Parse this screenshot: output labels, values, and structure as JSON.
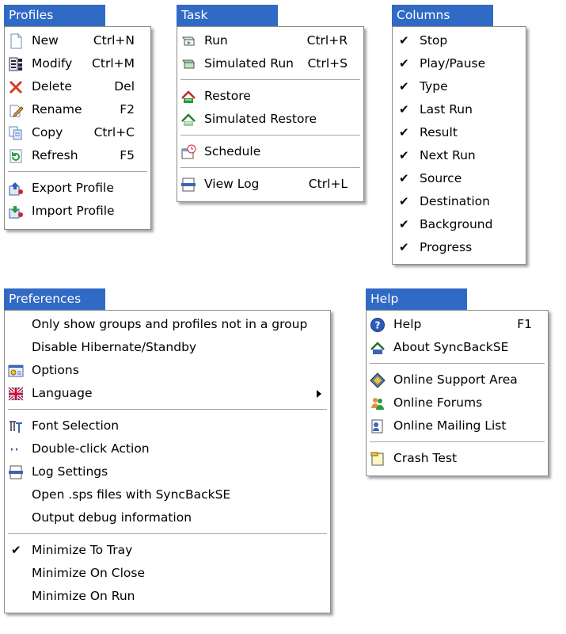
{
  "colors": {
    "title_bg": "#316ac5",
    "title_fg": "#ffffff",
    "menu_bg": "#ffffff",
    "separator": "#a5a5a5"
  },
  "profiles": {
    "title": "Profiles",
    "items": [
      {
        "label": "New",
        "shortcut": "Ctrl+N",
        "icon": "new-document-icon"
      },
      {
        "label": "Modify",
        "shortcut": "Ctrl+M",
        "icon": "modify-icon"
      },
      {
        "label": "Delete",
        "shortcut": "Del",
        "icon": "delete-x-icon"
      },
      {
        "label": "Rename",
        "shortcut": "F2",
        "icon": "rename-pencil-icon"
      },
      {
        "label": "Copy",
        "shortcut": "Ctrl+C",
        "icon": "copy-icon"
      },
      {
        "label": "Refresh",
        "shortcut": "F5",
        "icon": "refresh-icon"
      },
      {
        "label": "Export Profile",
        "shortcut": "",
        "icon": "export-profile-icon"
      },
      {
        "label": "Import Profile",
        "shortcut": "",
        "icon": "import-profile-icon"
      }
    ]
  },
  "task": {
    "title": "Task",
    "items": [
      {
        "label": "Run",
        "shortcut": "Ctrl+R",
        "icon": "run-icon"
      },
      {
        "label": "Simulated Run",
        "shortcut": "Ctrl+S",
        "icon": "simulated-run-icon"
      },
      {
        "label": "Restore",
        "shortcut": "",
        "icon": "restore-icon"
      },
      {
        "label": "Simulated Restore",
        "shortcut": "",
        "icon": "simulated-restore-icon"
      },
      {
        "label": "Schedule",
        "shortcut": "",
        "icon": "schedule-icon"
      },
      {
        "label": "View Log",
        "shortcut": "Ctrl+L",
        "icon": "view-log-icon"
      }
    ]
  },
  "columns": {
    "title": "Columns",
    "items": [
      {
        "label": "Stop",
        "checked": true
      },
      {
        "label": "Play/Pause",
        "checked": true
      },
      {
        "label": "Type",
        "checked": true
      },
      {
        "label": "Last Run",
        "checked": true
      },
      {
        "label": "Result",
        "checked": true
      },
      {
        "label": "Next Run",
        "checked": true
      },
      {
        "label": "Source",
        "checked": true
      },
      {
        "label": "Destination",
        "checked": true
      },
      {
        "label": "Background",
        "checked": true
      },
      {
        "label": "Progress",
        "checked": true
      }
    ]
  },
  "preferences": {
    "title": "Preferences",
    "items": [
      {
        "label": "Only show groups and profiles not in a group",
        "icon": ""
      },
      {
        "label": "Disable Hibernate/Standby",
        "icon": ""
      },
      {
        "label": "Options",
        "icon": "options-icon"
      },
      {
        "label": "Language",
        "icon": "language-flag-icon",
        "submenu": true
      },
      {
        "label": "Font Selection",
        "icon": "font-selection-icon"
      },
      {
        "label": "Double-click Action",
        "icon": "double-click-icon"
      },
      {
        "label": "Log Settings",
        "icon": "log-settings-icon"
      },
      {
        "label": "Open .sps files with SyncBackSE",
        "icon": ""
      },
      {
        "label": "Output debug information",
        "icon": ""
      },
      {
        "label": "Minimize To Tray",
        "checked": true
      },
      {
        "label": "Minimize On Close",
        "checked": false
      },
      {
        "label": "Minimize On Run",
        "checked": false
      }
    ]
  },
  "help": {
    "title": "Help",
    "items": [
      {
        "label": "Help",
        "shortcut": "F1",
        "icon": "help-question-icon"
      },
      {
        "label": "About SyncBackSE",
        "shortcut": "",
        "icon": "about-icon"
      },
      {
        "label": "Online Support Area",
        "shortcut": "",
        "icon": "online-support-icon"
      },
      {
        "label": "Online Forums",
        "shortcut": "",
        "icon": "online-forums-icon"
      },
      {
        "label": "Online Mailing List",
        "shortcut": "",
        "icon": "mailing-list-icon"
      },
      {
        "label": "Crash Test",
        "shortcut": "",
        "icon": "crash-test-icon"
      }
    ]
  }
}
